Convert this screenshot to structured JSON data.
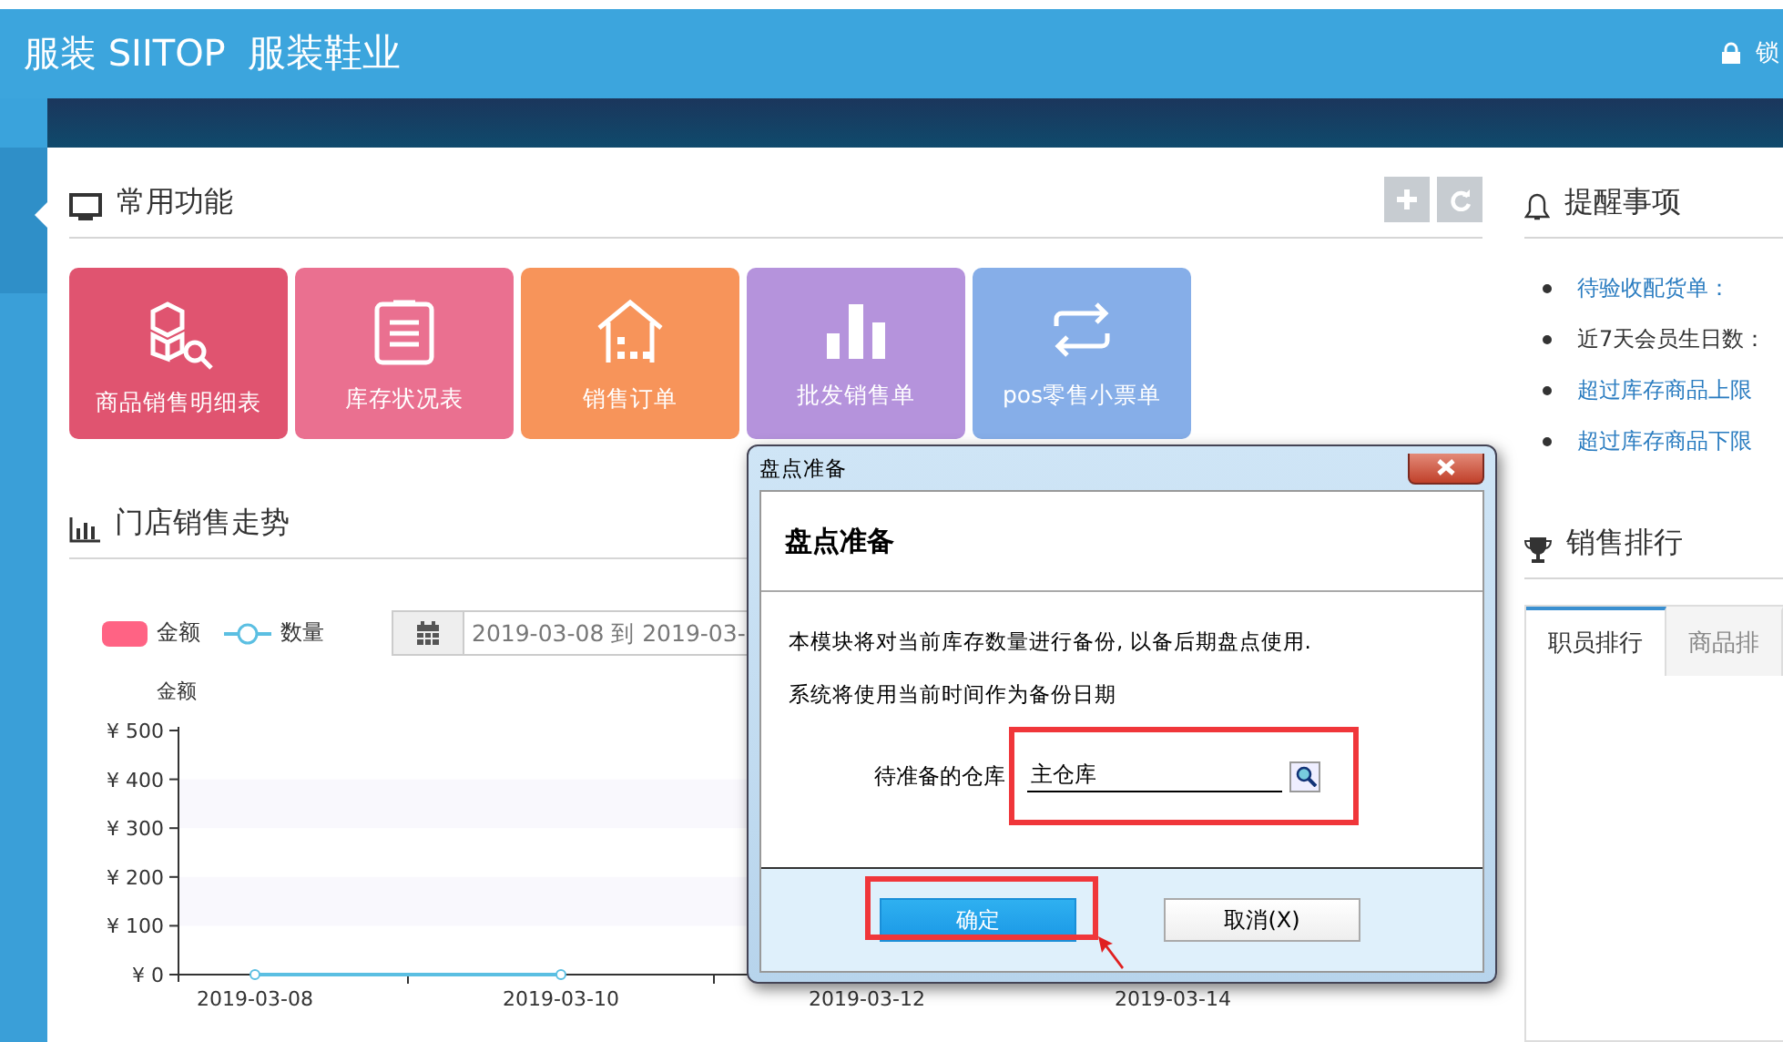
{
  "header": {
    "brand": "服装 SIITOP",
    "subtitle": "服装鞋业",
    "lock_label": "锁"
  },
  "common_functions": {
    "title": "常用功能",
    "tiles": [
      {
        "label": "商品销售明细表",
        "color": "#e05470"
      },
      {
        "label": "库存状况表",
        "color": "#ea7090"
      },
      {
        "label": "销售订单",
        "color": "#f7945a"
      },
      {
        "label": "批发销售单",
        "color": "#b593dc"
      },
      {
        "label": "pos零售小票单",
        "color": "#86aee8"
      }
    ]
  },
  "sales_trend": {
    "title": "门店销售走势",
    "legend": [
      {
        "label": "金额",
        "color": "#ff6384"
      }
    ],
    "date_range": "2019-03-08 到 2019-03-",
    "chart_data": {
      "type": "line",
      "ylabel": "金额",
      "categories": [
        "2019-03-08",
        "2019-03-10",
        "2019-03-12",
        "2019-03-14"
      ],
      "ylim": [
        0,
        500
      ],
      "yticks": [
        {
          "value": 0,
          "label": "¥ 0"
        },
        {
          "value": 100,
          "label": "¥ 100"
        },
        {
          "value": 200,
          "label": "¥ 200"
        },
        {
          "value": 300,
          "label": "¥ 300"
        },
        {
          "value": 400,
          "label": "¥ 400"
        },
        {
          "value": 500,
          "label": "¥ 500"
        }
      ],
      "series": [
        {
          "name": "数量",
          "color": "#5bbfe2",
          "marker": true,
          "values": [
            0,
            0,
            null,
            null
          ]
        }
      ]
    }
  },
  "reminders": {
    "title": "提醒事项",
    "items": [
      {
        "label": "待验收配货单：",
        "link": true
      },
      {
        "label": "近7天会员生日数：",
        "link": false
      },
      {
        "label": "超过库存商品上限",
        "link": true
      },
      {
        "label": "超过库存商品下限",
        "link": true
      }
    ]
  },
  "ranking": {
    "title": "销售排行",
    "tabs": [
      {
        "label": "职员排行",
        "selected": true
      },
      {
        "label": "商品排",
        "selected": false
      }
    ]
  },
  "dialog": {
    "title": "盘点准备",
    "heading": "盘点准备",
    "lines": [
      "本模块将对当前库存数量进行备份, 以备后期盘点使用.",
      "系统将使用当前时间作为备份日期"
    ],
    "field_label": "待准备的仓库",
    "field_value": "主仓库",
    "buttons": [
      {
        "label": "确定",
        "primary": true
      },
      {
        "label": "取消(X)",
        "primary": false
      }
    ]
  }
}
